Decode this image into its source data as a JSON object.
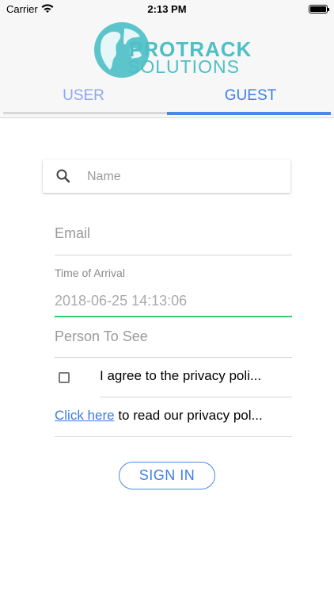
{
  "status_bar": {
    "carrier": "Carrier",
    "time": "2:13 PM"
  },
  "logo": {
    "line1": "PROTRACK",
    "line2": "SOLUTIONS"
  },
  "tabs": [
    {
      "label": "USER"
    },
    {
      "label": "GUEST",
      "active": true
    }
  ],
  "search": {
    "placeholder": "Name"
  },
  "form": {
    "email_placeholder": "Email",
    "arrival_label": "Time of Arrival",
    "arrival_value": "2018-06-25 14:13:06",
    "person_placeholder": "Person To See",
    "agree_text": "I agree to the privacy poli...",
    "agree_checked": false,
    "privacy_link": "Click here",
    "privacy_rest": " to read our privacy pol..."
  },
  "signin_label": "SIGN IN",
  "colors": {
    "accent": "#3a7fe8",
    "logo": "#4dbfc6",
    "focus_underline": "#2fd06a"
  }
}
